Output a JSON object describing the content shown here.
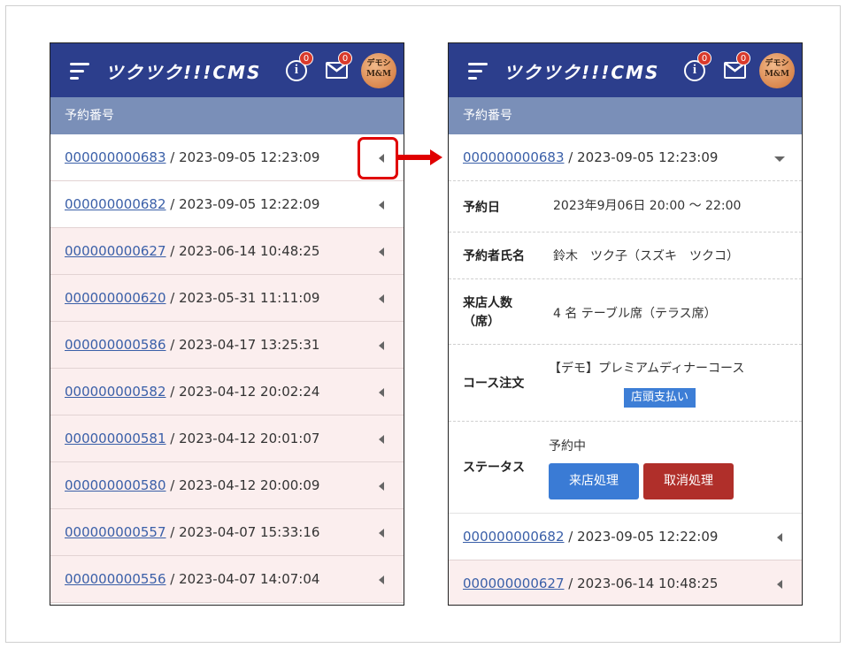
{
  "header": {
    "logo": "ツクツク!!!CMS",
    "info_badge": "0",
    "mail_badge": "0",
    "avatar_text_1": "デモシ",
    "avatar_text_2": "M&M"
  },
  "subheader": "予約番号",
  "left_list": [
    {
      "id": "000000000683",
      "datetime": " / 2023-09-05 12:23:09",
      "bg": "white"
    },
    {
      "id": "000000000682",
      "datetime": " / 2023-09-05 12:22:09",
      "bg": "white"
    },
    {
      "id": "000000000627",
      "datetime": " / 2023-06-14 10:48:25",
      "bg": "pink"
    },
    {
      "id": "000000000620",
      "datetime": " / 2023-05-31 11:11:09",
      "bg": "pink"
    },
    {
      "id": "000000000586",
      "datetime": " / 2023-04-17 13:25:31",
      "bg": "pink"
    },
    {
      "id": "000000000582",
      "datetime": " / 2023-04-12 20:02:24",
      "bg": "pink"
    },
    {
      "id": "000000000581",
      "datetime": " / 2023-04-12 20:01:07",
      "bg": "pink"
    },
    {
      "id": "000000000580",
      "datetime": " / 2023-04-12 20:00:09",
      "bg": "pink"
    },
    {
      "id": "000000000557",
      "datetime": " / 2023-04-07 15:33:16",
      "bg": "pink"
    },
    {
      "id": "000000000556",
      "datetime": " / 2023-04-07 14:07:04",
      "bg": "pink"
    }
  ],
  "right": {
    "expanded": {
      "id": "000000000683",
      "datetime": " / 2023-09-05 12:23:09"
    },
    "details": {
      "date_label": "予約日",
      "date_value": "2023年9月06日 20:00 ～ 22:00",
      "name_label": "予約者氏名",
      "name_value": "鈴木　ツク子（スズキ　ツクコ）",
      "people_label_1": "来店人数",
      "people_label_2": "（席）",
      "people_value": "4 名 テーブル席（テラス席）",
      "course_label": "コース注文",
      "course_value": "【デモ】プレミアムディナーコース",
      "payment": "店頭支払い",
      "status_label": "ステータス",
      "status_value": "予約中",
      "visit_button": "来店処理",
      "cancel_button": "取消処理"
    },
    "after": [
      {
        "id": "000000000682",
        "datetime": " / 2023-09-05 12:22:09",
        "bg": "white"
      },
      {
        "id": "000000000627",
        "datetime": " / 2023-06-14 10:48:25",
        "bg": "pink"
      }
    ]
  },
  "colors": {
    "header": "#2c3e8c",
    "subheader": "#7a8fb8",
    "link": "#3a5fa8",
    "highlight": "#e00000",
    "visit_button": "#3a7bd5",
    "cancel_button": "#b02f2a"
  }
}
